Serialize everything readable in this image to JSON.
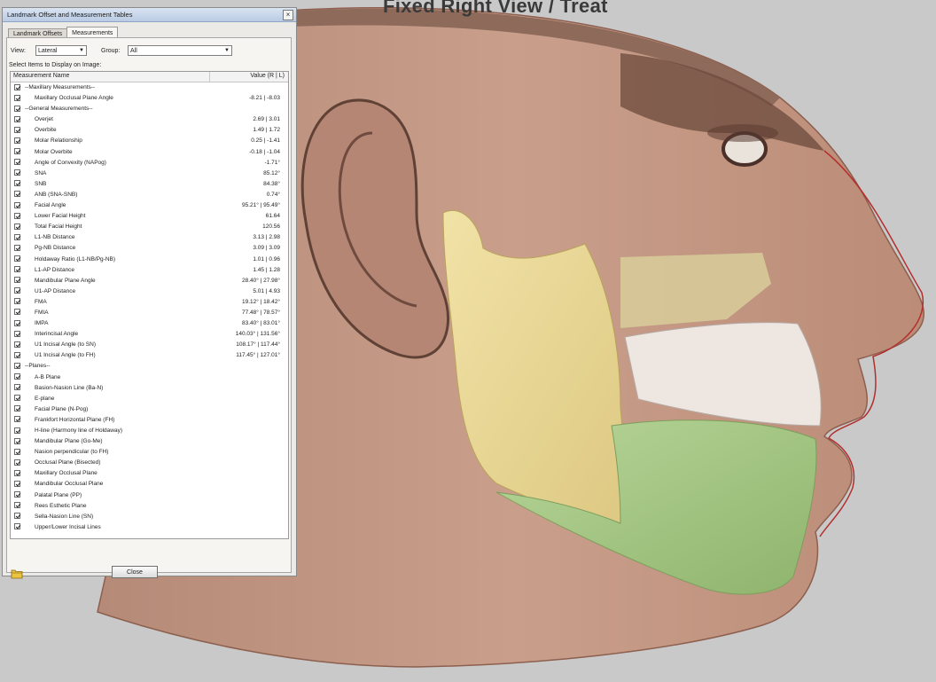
{
  "viewport": {
    "title": "Fixed Right View / Treat"
  },
  "dialog": {
    "title": "Landmark Offset and Measurement Tables",
    "close_glyph": "×",
    "tabs": [
      {
        "label": "Landmark Offsets",
        "active": false
      },
      {
        "label": "Measurements",
        "active": true
      }
    ],
    "view_label": "View:",
    "view_value": "Lateral",
    "group_label": "Group:",
    "group_value": "All",
    "select_label": "Select Items to Display on Image:",
    "table": {
      "headers": [
        "Measurement Name",
        "Value (R | L)"
      ],
      "rows": [
        {
          "name": "--Maxillary Measurements--",
          "value": "",
          "indent": false
        },
        {
          "name": "Maxillary Occlusal Plane Angle",
          "value": "-8.21 | -8.03",
          "indent": true
        },
        {
          "name": "--General Measurements--",
          "value": "",
          "indent": false
        },
        {
          "name": "Overjet",
          "value": "2.69 | 3.01",
          "indent": true
        },
        {
          "name": "Overbite",
          "value": "1.49 | 1.72",
          "indent": true
        },
        {
          "name": "Molar Relationship",
          "value": "0.25 | -1.41",
          "indent": true
        },
        {
          "name": "Molar Overbite",
          "value": "-0.18 | -1.04",
          "indent": true
        },
        {
          "name": "Angle of Convexity (NAPog)",
          "value": "-1.71°",
          "indent": true
        },
        {
          "name": "SNA",
          "value": "85.12°",
          "indent": true
        },
        {
          "name": "SNB",
          "value": "84.38°",
          "indent": true
        },
        {
          "name": "ANB (SNA-SNB)",
          "value": "0.74°",
          "indent": true
        },
        {
          "name": "Facial Angle",
          "value": "95.21° | 95.49°",
          "indent": true
        },
        {
          "name": "Lower Facial Height",
          "value": "61.64",
          "indent": true
        },
        {
          "name": "Total Facial Height",
          "value": "120.56",
          "indent": true
        },
        {
          "name": "L1-NB Distance",
          "value": "3.13 | 2.98",
          "indent": true
        },
        {
          "name": "Pg-NB Distance",
          "value": "3.09 | 3.09",
          "indent": true
        },
        {
          "name": "Holdaway Ratio (L1-NB/Pg-NB)",
          "value": "1.01 | 0.96",
          "indent": true
        },
        {
          "name": "L1-AP Distance",
          "value": "1.45 | 1.28",
          "indent": true
        },
        {
          "name": "Mandibular Plane Angle",
          "value": "28.40° | 27.98°",
          "indent": true
        },
        {
          "name": "U1-AP Distance",
          "value": "5.01 | 4.93",
          "indent": true
        },
        {
          "name": "FMA",
          "value": "19.12° | 18.42°",
          "indent": true
        },
        {
          "name": "FMIA",
          "value": "77.48° | 78.57°",
          "indent": true
        },
        {
          "name": "IMPA",
          "value": "83.40° | 83.01°",
          "indent": true
        },
        {
          "name": "Interincisal Angle",
          "value": "140.03° | 131.56°",
          "indent": true
        },
        {
          "name": "U1 Incisal Angle (to SN)",
          "value": "108.17° | 117.44°",
          "indent": true
        },
        {
          "name": "U1 Incisal Angle (to FH)",
          "value": "117.45° | 127.01°",
          "indent": true
        },
        {
          "name": "--Planes--",
          "value": "",
          "indent": false
        },
        {
          "name": "A-B Plane",
          "value": "",
          "indent": true
        },
        {
          "name": "Basion-Nasion Line (Ba-N)",
          "value": "",
          "indent": true
        },
        {
          "name": "E-plane",
          "value": "",
          "indent": true
        },
        {
          "name": "Facial Plane (N-Pog)",
          "value": "",
          "indent": true
        },
        {
          "name": "Frankfort Horizontal Plane (FH)",
          "value": "",
          "indent": true
        },
        {
          "name": "H-line (Harmony line of Holdaway)",
          "value": "",
          "indent": true
        },
        {
          "name": "Mandibular Plane (Go-Me)",
          "value": "",
          "indent": true
        },
        {
          "name": "Nasion perpendicular (to FH)",
          "value": "",
          "indent": true
        },
        {
          "name": "Occlusal Plane (Bisected)",
          "value": "",
          "indent": true
        },
        {
          "name": "Maxillary Occlusal Plane",
          "value": "",
          "indent": true
        },
        {
          "name": "Mandibular Occlusal Plane",
          "value": "",
          "indent": true
        },
        {
          "name": "Palatal Plane (PP)",
          "value": "",
          "indent": true
        },
        {
          "name": "Rees Esthetic Plane",
          "value": "",
          "indent": true
        },
        {
          "name": "Sella-Nasion Line (SN)",
          "value": "",
          "indent": true
        },
        {
          "name": "Upper/Lower Incisal Lines",
          "value": "",
          "indent": true
        }
      ]
    },
    "close_label": "Close"
  },
  "colors": {
    "skin": "#c49a86",
    "mandible": "#e9d89a",
    "teeth": "#efe7e2",
    "lower_jaw": "#a9c98a",
    "background": "#c9c9c9"
  }
}
